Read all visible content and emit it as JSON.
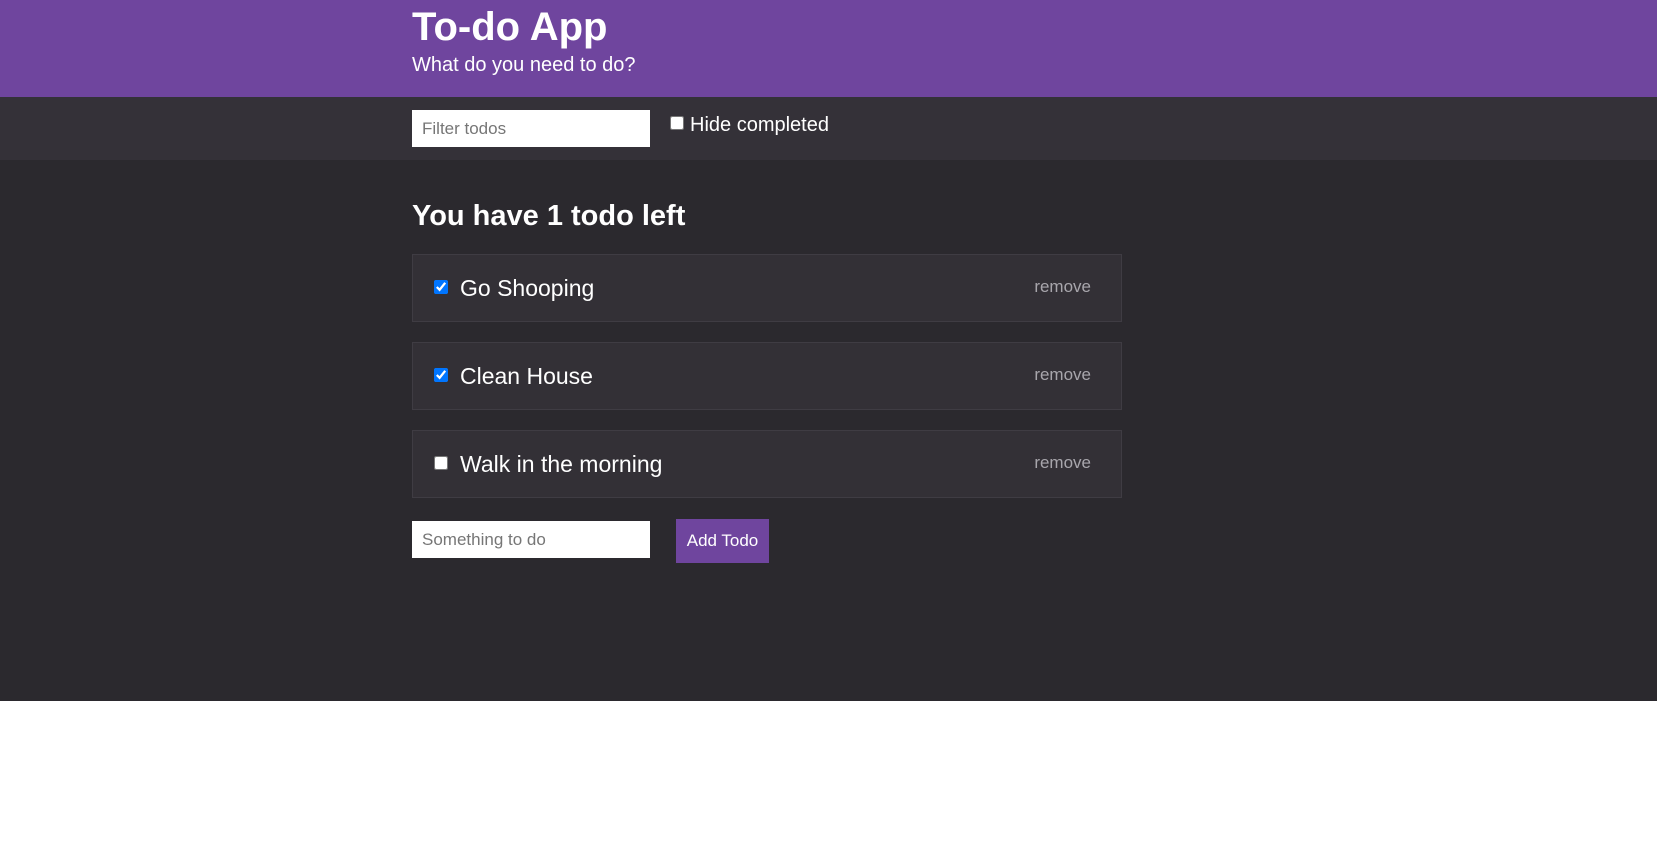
{
  "header": {
    "title": "To-do App",
    "subtitle": "What do you need to do?"
  },
  "filters": {
    "search_placeholder": "Filter todos",
    "search_value": "",
    "hide_completed_label": "Hide completed",
    "hide_completed_checked": false
  },
  "summary": "You have 1 todo left",
  "todos": [
    {
      "text": "Go Shooping",
      "completed": true,
      "remove_label": "remove"
    },
    {
      "text": "Clean House",
      "completed": true,
      "remove_label": "remove"
    },
    {
      "text": "Walk in the morning",
      "completed": false,
      "remove_label": "remove"
    }
  ],
  "add_form": {
    "placeholder": "Something to do",
    "value": "",
    "button_label": "Add Todo"
  },
  "colors": {
    "accent": "#6f459e",
    "background": "#2b292e",
    "filter_bar": "#343138",
    "item_background": "#333036"
  }
}
